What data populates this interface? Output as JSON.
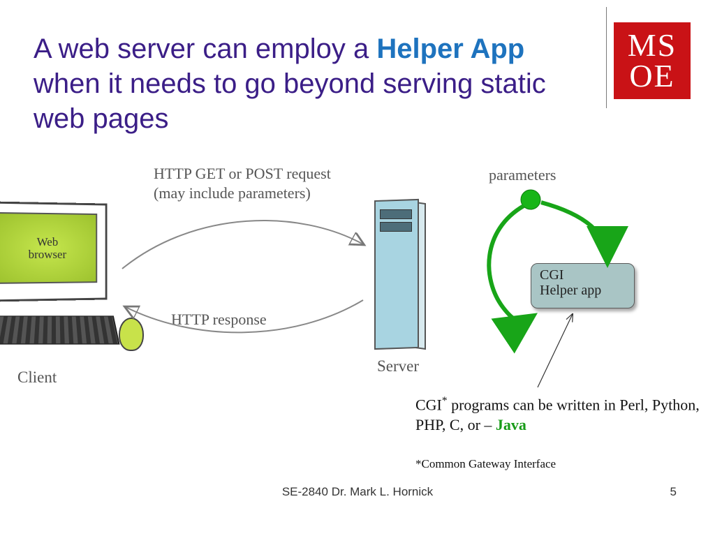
{
  "title": {
    "part1": "A web server can employ a ",
    "accent": "Helper App",
    "part2": " when it needs to go beyond serving static web pages"
  },
  "logo": {
    "line1": "MS",
    "line2": "OE"
  },
  "labels": {
    "request": "HTTP GET or POST request\n(may include parameters)",
    "response": "HTTP response",
    "client": "Client",
    "server": "Server",
    "parameters": "parameters",
    "browser": "Web\nbrowser"
  },
  "cgi_box": {
    "line1": "CGI",
    "line2": "Helper app"
  },
  "cgi_note": {
    "prefix": "CGI",
    "sup": "*",
    "body": " programs can be written in Perl, Python, PHP, C, or – ",
    "java": "Java"
  },
  "footnote": "*Common Gateway Interface",
  "attribution": "SE-2840 Dr. Mark L. Hornick",
  "page_number": "5"
}
